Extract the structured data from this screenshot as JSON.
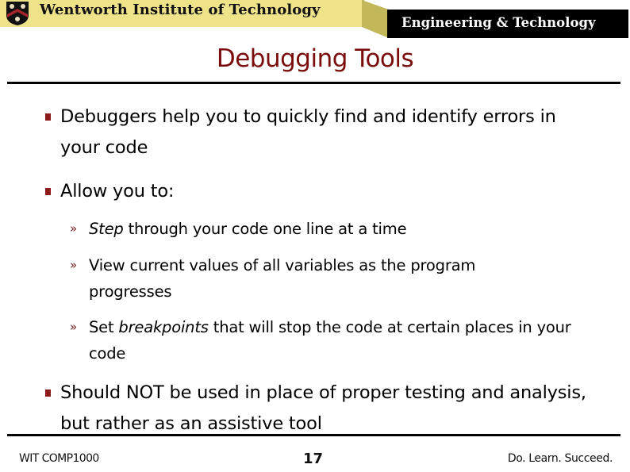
{
  "header": {
    "institution": "Wentworth Institute of Technology",
    "department": "Engineering & Technology",
    "logo_icon": "crest-shield-icon",
    "colors": {
      "banner_yellow": "#efe38a",
      "banner_black": "#000000",
      "connector_olive": "#c2b85a"
    }
  },
  "slide": {
    "title": "Debugging Tools",
    "title_color": "#7a0c0c",
    "bullet_color": "#8b1a1a",
    "bullets": [
      {
        "text": "Debuggers help you to quickly find and identify errors in your code"
      },
      {
        "text": "Allow you to:",
        "sub_items": [
          {
            "emphasis": "Step",
            "rest": " through your code one line at a time"
          },
          {
            "text": "View current values of all variables as the program progresses"
          },
          {
            "prefix": "Set ",
            "emphasis": "breakpoints",
            "rest": " that will stop the code at certain places in your code"
          }
        ]
      },
      {
        "text": "Should NOT be used in place of proper testing and analysis, but rather as an assistive tool"
      }
    ],
    "sub_bullet_glyph": "»"
  },
  "footer": {
    "course": "WIT COMP1000",
    "page_number": "17",
    "motto": "Do. Learn. Succeed."
  }
}
